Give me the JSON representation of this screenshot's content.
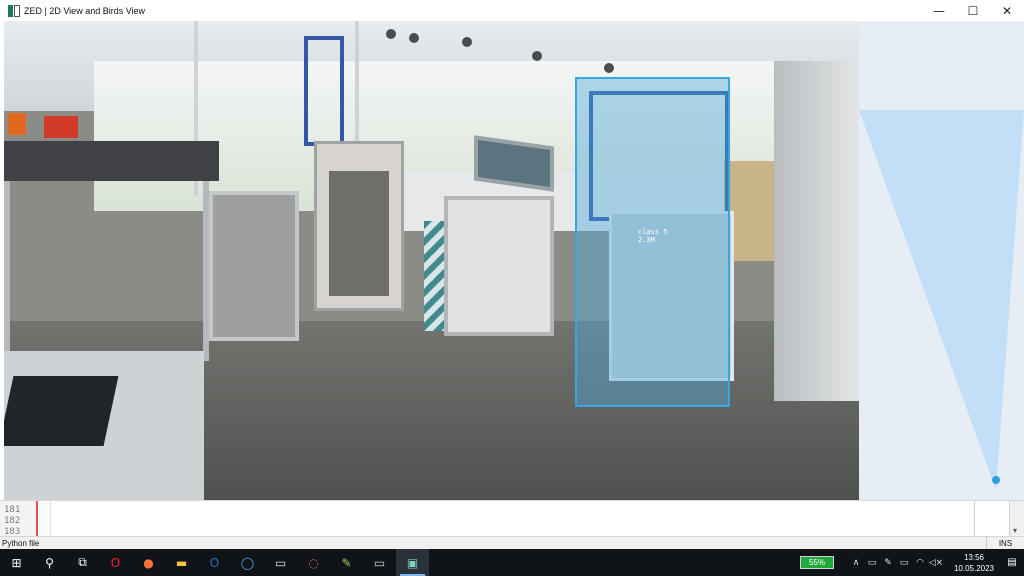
{
  "window": {
    "title": "ZED | 2D View and Birds View",
    "controls": {
      "minimize": "—",
      "maximize": "☐",
      "close": "✕"
    }
  },
  "detection": {
    "label": "class 5",
    "distance": "2.3M",
    "box_color": "#3aa6df"
  },
  "birds_view": {
    "background": "#e7edf5",
    "cone_color": "#c2dff7",
    "target_dot_color": "#2f9fe0"
  },
  "editor": {
    "line_numbers": [
      "181",
      "182",
      "183"
    ],
    "scroll_arrow": "▾"
  },
  "statusbar": {
    "file_type": "Python file",
    "mode": "INS"
  },
  "taskbar": {
    "apps": [
      {
        "name": "windows-start-icon",
        "glyph": "⊞",
        "color": "#ffffff"
      },
      {
        "name": "search-icon",
        "glyph": "⚲",
        "color": "#ffffff"
      },
      {
        "name": "task-view-icon",
        "glyph": "⧉",
        "color": "#ffffff"
      },
      {
        "name": "opera-icon",
        "glyph": "O",
        "color": "#ff1b2d"
      },
      {
        "name": "firefox-icon",
        "glyph": "●",
        "color": "#ff7139"
      },
      {
        "name": "file-explorer-icon",
        "glyph": "▬",
        "color": "#f6c344"
      },
      {
        "name": "outlook-icon",
        "glyph": "O",
        "color": "#1a73c9"
      },
      {
        "name": "signal-icon",
        "glyph": "◯",
        "color": "#5aa3f0"
      },
      {
        "name": "terminal-icon",
        "glyph": "▭",
        "color": "#dddddd"
      },
      {
        "name": "jupyter-icon",
        "glyph": "◌",
        "color": "#f37626"
      },
      {
        "name": "notepad-icon",
        "glyph": "✎",
        "color": "#9ccf5a"
      },
      {
        "name": "console-window-icon",
        "glyph": "▭",
        "color": "#cfcfcf"
      },
      {
        "name": "zed-app-icon",
        "glyph": "▣",
        "color": "#7fd0c9"
      }
    ],
    "battery": "55%",
    "tray": {
      "chevron": "∧",
      "meet_now": "▭",
      "pen": "✎",
      "display": "▭",
      "network": "◠",
      "volume": "◁×"
    },
    "clock_time": "13:56",
    "clock_date": "10.05.2023",
    "notifications": "▤"
  }
}
